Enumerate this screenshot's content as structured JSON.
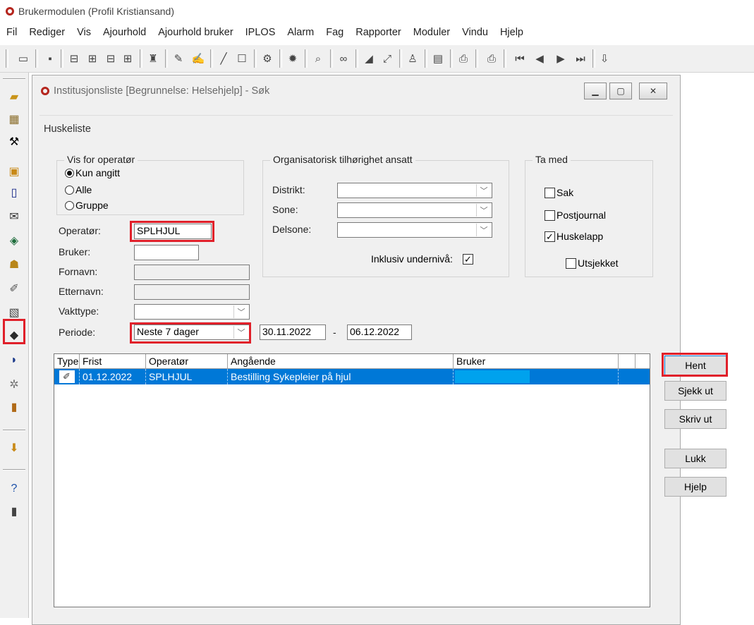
{
  "app": {
    "title": "Brukermodulen (Profil Kristiansand)"
  },
  "menu": [
    "Fil",
    "Rediger",
    "Vis",
    "Ajourhold",
    "Ajourhold bruker",
    "IPLOS",
    "Alarm",
    "Fag",
    "Rapporter",
    "Moduler",
    "Vindu",
    "Hjelp"
  ],
  "window": {
    "title": "Institusjonsliste  [Begrunnelse: Helsehjelp] - Søk",
    "subtitle": "Huskeliste"
  },
  "vis_for_operator": {
    "title": "Vis for operatør",
    "options": [
      "Kun angitt",
      "Alle",
      "Gruppe"
    ],
    "selected": "Kun angitt"
  },
  "form": {
    "operator_label": "Operatør:",
    "operator_value": "SPLHJUL",
    "bruker_label": "Bruker:",
    "bruker_value": "",
    "fornavn_label": "Fornavn:",
    "etternavn_label": "Etternavn:",
    "vakttype_label": "Vakttype:",
    "periode_label": "Periode:",
    "periode_value": "Neste 7 dager",
    "date_from": "30.11.2022",
    "date_sep": "-",
    "date_to": "06.12.2022"
  },
  "org": {
    "title": "Organisatorisk tilhørighet ansatt",
    "distrikt_label": "Distrikt:",
    "sone_label": "Sone:",
    "delsone_label": "Delsone:",
    "inklusiv_label": "Inklusiv undernivå:",
    "inklusiv_checked": true
  },
  "ta_med": {
    "title": "Ta med",
    "sak": {
      "label": "Sak",
      "checked": false
    },
    "postjournal": {
      "label": "Postjournal",
      "checked": false
    },
    "huskelapp": {
      "label": "Huskelapp",
      "checked": true
    },
    "utsjekket": {
      "label": "Utsjekket",
      "checked": false
    }
  },
  "list": {
    "columns": [
      "Type",
      "Frist",
      "Operatør",
      "Angående",
      "Bruker"
    ],
    "rows": [
      {
        "type_icon": "note-icon",
        "frist": "01.12.2022",
        "operator": "SPLHJUL",
        "angaende": "Bestilling Sykepleier på hjul",
        "bruker": ""
      }
    ]
  },
  "buttons": {
    "hent": "Hent",
    "sjekk_ut": "Sjekk ut",
    "skriv_ut": "Skriv ut",
    "lukk": "Lukk",
    "hjelp": "Hjelp"
  },
  "colors": {
    "selection": "#0078d7",
    "highlight": "#e0202a",
    "app_icon": "#b5261e"
  }
}
